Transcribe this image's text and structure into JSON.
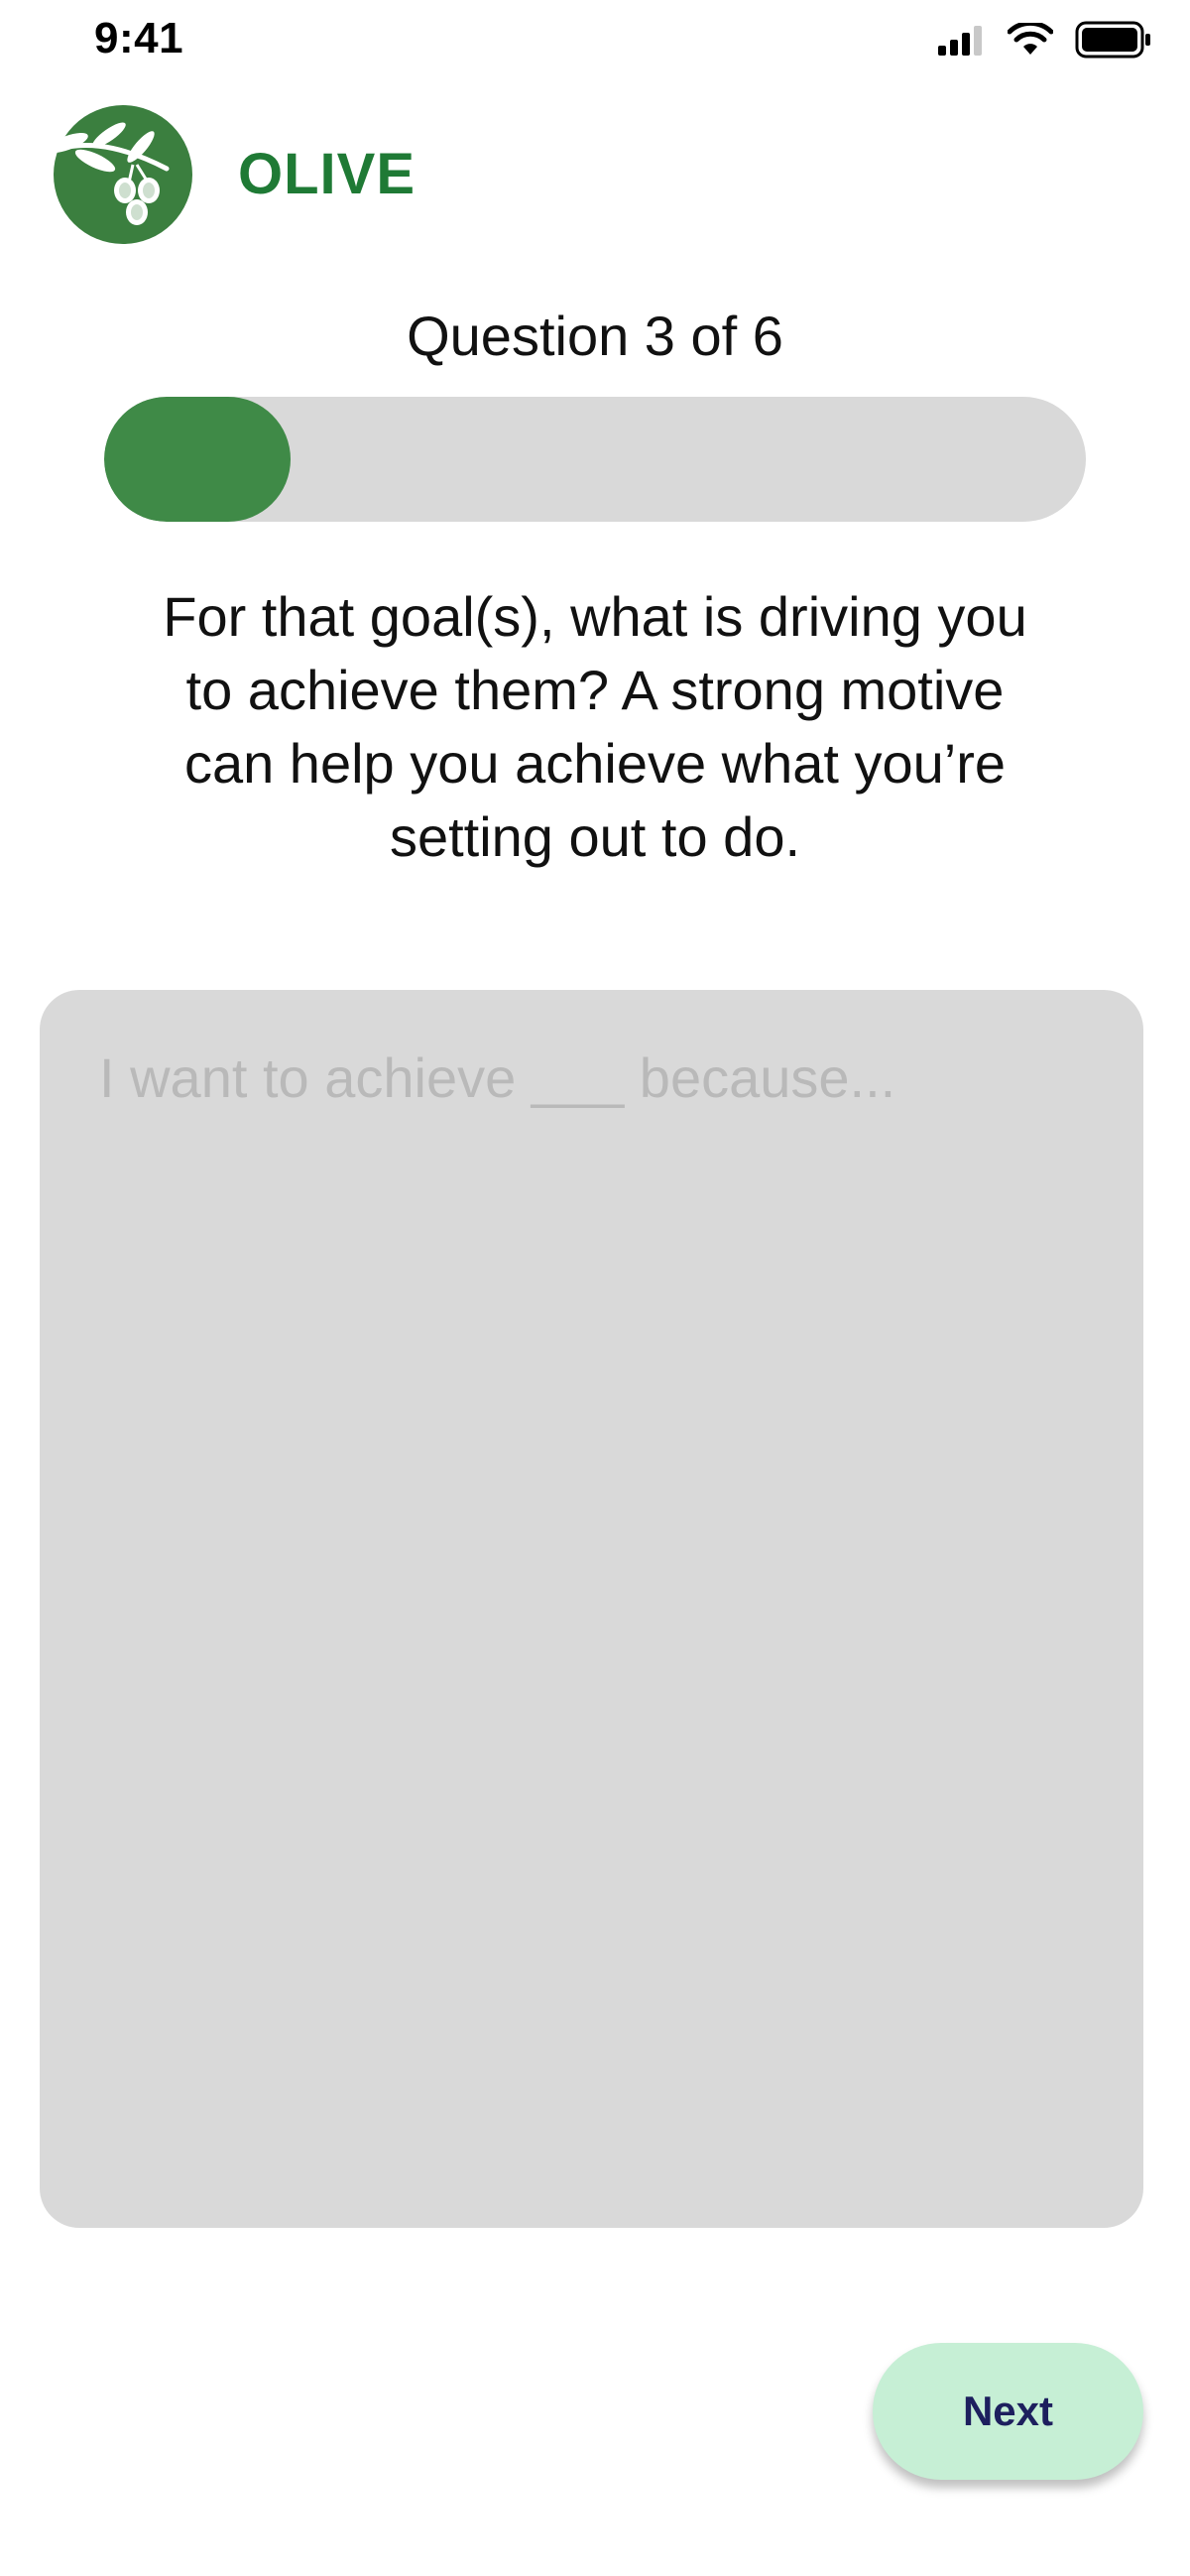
{
  "status_bar": {
    "time": "9:41",
    "icons": [
      "cellular-signal-icon",
      "wifi-icon",
      "battery-icon"
    ]
  },
  "brand": {
    "name": "OLIVE",
    "logo_icon": "olive-branch-logo",
    "color": "#1f7a35"
  },
  "progress": {
    "label": "Question 3 of 6",
    "current": 3,
    "total": 6,
    "fill_fraction": 0.19,
    "fill_color": "#3f8a47",
    "track_color": "#d9d9d9"
  },
  "prompt": {
    "text": "For that goal(s), what is driving you to achieve them? A strong motive can help you achieve what you’re setting out to do."
  },
  "answer": {
    "placeholder": "I want to achieve ___ because...",
    "value": ""
  },
  "actions": {
    "next_label": "Next",
    "next_bg": "#c6efd5",
    "next_text_color": "#1d1f5e"
  }
}
